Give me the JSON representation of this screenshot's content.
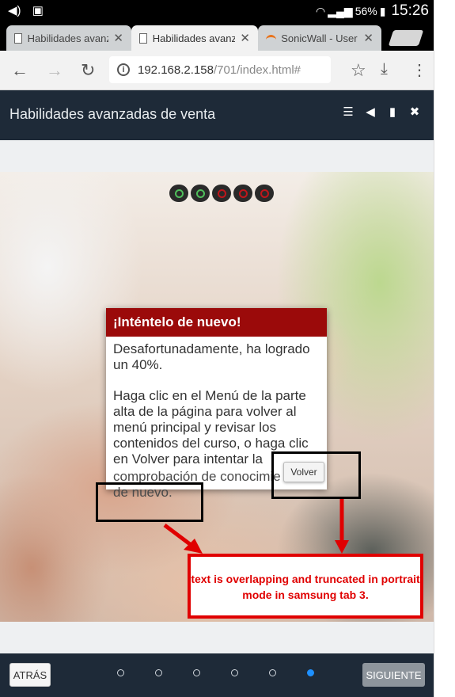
{
  "status_bar": {
    "icons": [
      "volume-icon",
      "sim-icon",
      "wifi-icon",
      "signal-icon",
      "battery-icon"
    ],
    "battery": "56%",
    "time": "15:26"
  },
  "browser": {
    "tabs": [
      {
        "title": "Habilidades avanz",
        "active": false,
        "icon": "document-icon"
      },
      {
        "title": "Habilidades avanz",
        "active": true,
        "icon": "document-icon"
      },
      {
        "title": "SonicWall - User",
        "active": false,
        "icon": "sonicwall-icon"
      }
    ],
    "url_host": "192.168.2.158",
    "url_path": "/701/index.html#"
  },
  "course": {
    "title": "Habilidades avanzadas de venta",
    "header_icons": [
      "menu-list-icon",
      "audio-icon",
      "glossary-icon",
      "close-icon"
    ]
  },
  "progress": [
    "correct",
    "correct",
    "incorrect",
    "incorrect",
    "incorrect"
  ],
  "modal": {
    "title": "¡Inténtelo de nuevo!",
    "score_text": "Desafortunadamente, ha logrado un 40%.",
    "instructions": "Haga clic en el Menú de la parte alta de la página para volver al menú principal y revisar los contenidos del curso, o haga clic en Volver para intentar la",
    "overflow_line1": "comprobación de conocimie",
    "overflow_line2": "de nuevo.",
    "button_label": "Volver"
  },
  "annotation": {
    "note": "text is overlapping and truncated in portrait mode in samsung tab 3.",
    "color": "#e00000"
  },
  "bottom_nav": {
    "back_label": "ATRÁS",
    "next_label": "SIGUIENTE",
    "dots_total": 6,
    "active_dot": 6
  }
}
